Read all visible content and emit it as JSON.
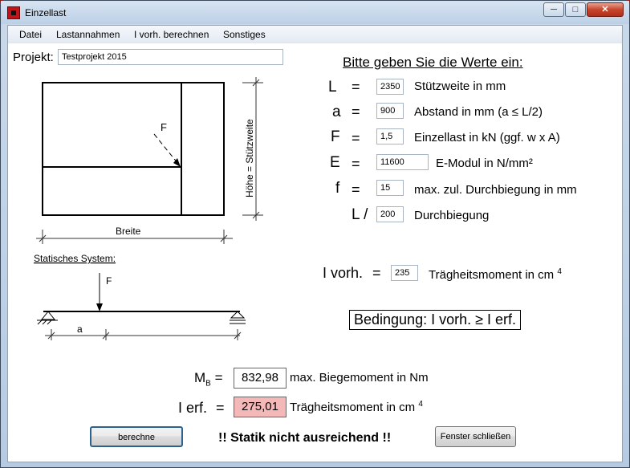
{
  "window": {
    "title": "Einzellast",
    "minimize": "─",
    "maximize": "□",
    "close": "✕"
  },
  "menu": [
    "Datei",
    "Lastannahmen",
    "I vorh. berechnen",
    "Sonstiges"
  ],
  "project": {
    "label": "Projekt:",
    "value": "Testprojekt 2015"
  },
  "heading": "Bitte geben Sie die Werte ein:",
  "inputs": [
    {
      "symbol": "L",
      "eq": "=",
      "value": "2350",
      "desc": "Stützweite in mm"
    },
    {
      "symbol": "a",
      "eq": "=",
      "value": "900",
      "desc": "Abstand in mm  (a  ≤  L/2)"
    },
    {
      "symbol": "F",
      "eq": "=",
      "value": "1,5",
      "desc": "Einzellast in kN (ggf. w x A)"
    },
    {
      "symbol": "E",
      "eq": "=",
      "value": "11600",
      "desc": "E-Modul in N/mm²"
    },
    {
      "symbol": "f",
      "eq": "=",
      "value": "15",
      "desc": "max. zul. Durchbiegung in mm"
    },
    {
      "symbol": "L /",
      "eq": "",
      "value": "200",
      "desc": "Durchbiegung"
    }
  ],
  "ivorh": {
    "label": "I vorh.",
    "eq": "=",
    "value": "235",
    "desc": "Trägheitsmoment in cm",
    "sup": "4"
  },
  "condition": "Bedingung:   I vorh.  ≥  I erf.",
  "diagram": {
    "force": "F",
    "width_label": "Breite",
    "height_label": "Höhe = Stützweite",
    "system_title": "Statisches System:",
    "system_force": "F",
    "system_a": "a"
  },
  "results": {
    "mb_label": "M",
    "mb_sub": "B",
    "mb_eq": "=",
    "mb_value": "832,98",
    "mb_desc": "max. Biegemoment in Nm",
    "ierf_label": "I erf.",
    "ierf_eq": "=",
    "ierf_value": "275,01",
    "ierf_desc": "Trägheitsmoment in cm",
    "ierf_sup": "4",
    "ierf_color": "#f4b8b8"
  },
  "buttons": {
    "compute": "berechne",
    "close": "Fenster schließen"
  },
  "status": "!! Statik nicht ausreichend !!"
}
